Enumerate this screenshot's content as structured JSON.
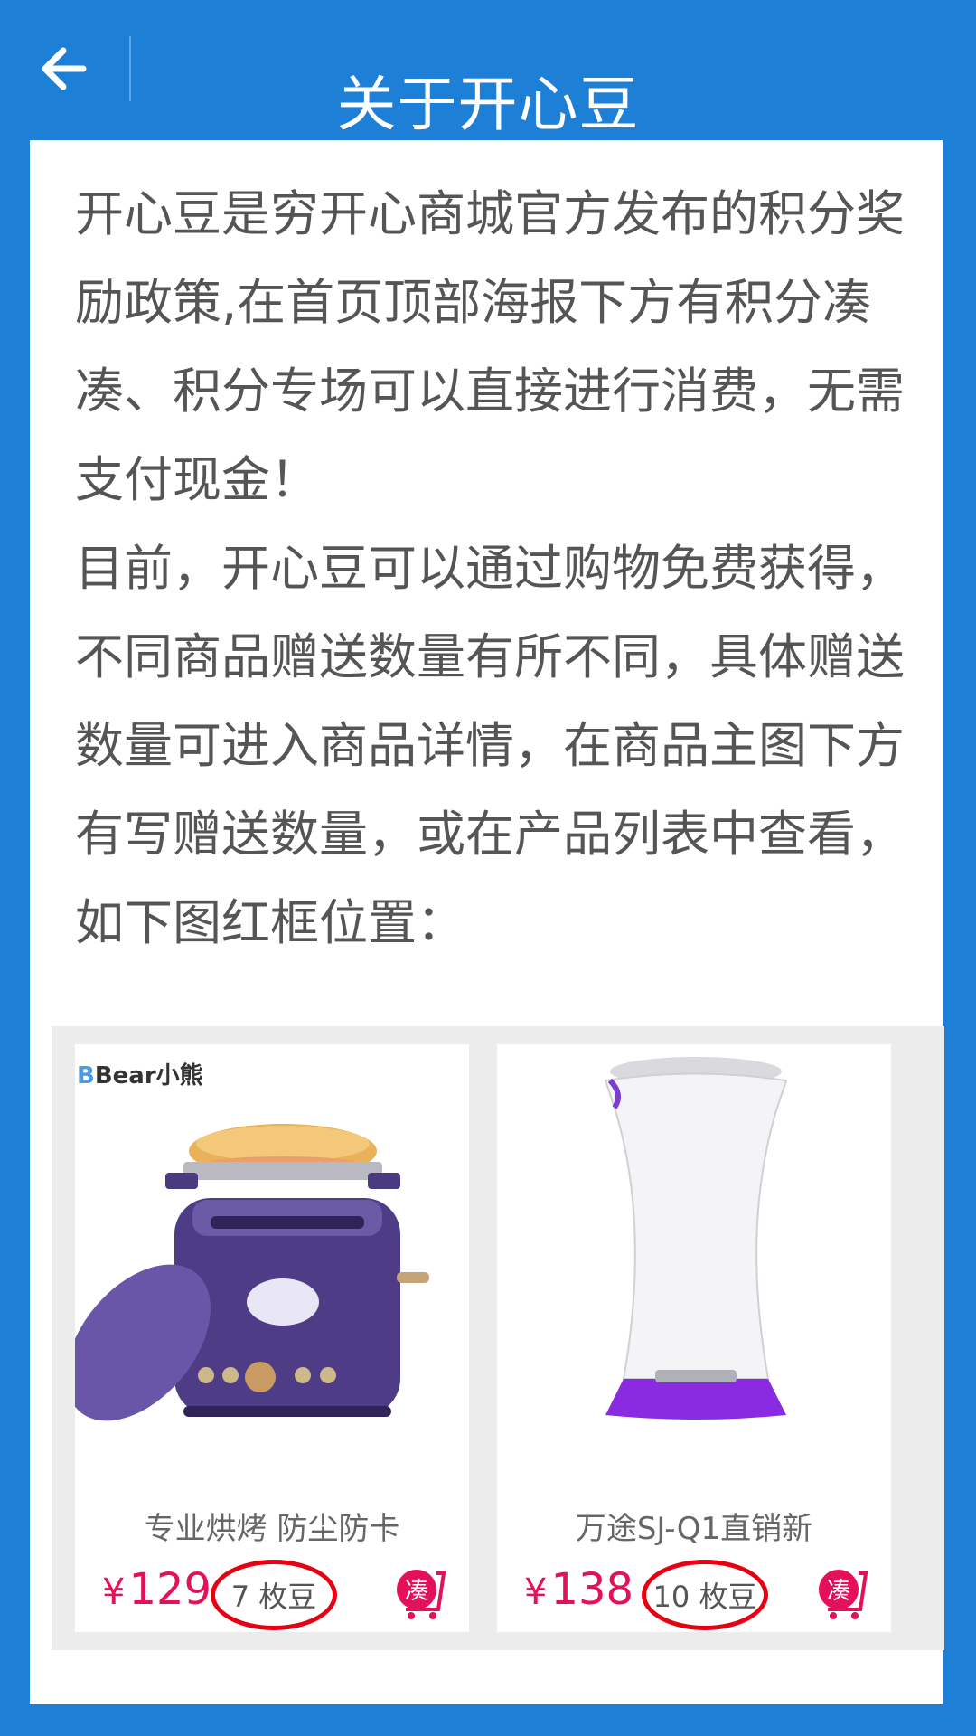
{
  "header": {
    "title": "关于开心豆",
    "back_icon": "arrow-left-icon"
  },
  "article": {
    "para1": "开心豆是穷开心商城官方发布的积分奖励政策,在首页顶部海报下方有积分凑凑、积分专场可以直接进行消费，无需支付现金！",
    "para2": "目前，开心豆可以通过购物免费获得，不同商品赠送数量有所不同，具体赠送数量可进入商品详情，在商品主图下方有写赠送数量，或在产品列表中查看，如下图红框位置："
  },
  "products": [
    {
      "brand": "Bear小熊",
      "name": "专业烘烤 防尘防卡",
      "currency": "¥",
      "price": "129",
      "beans": "7 枚豆",
      "cou_label": "凑",
      "icon": "toaster-image"
    },
    {
      "brand": "",
      "name": "万途SJ-Q1直销新",
      "currency": "¥",
      "price": "138",
      "beans": "10 枚豆",
      "cou_label": "凑",
      "icon": "humidifier-image"
    }
  ],
  "colors": {
    "header_bg": "#1e7fd6",
    "price": "#e3105a",
    "highlight_circle": "#e60012"
  }
}
